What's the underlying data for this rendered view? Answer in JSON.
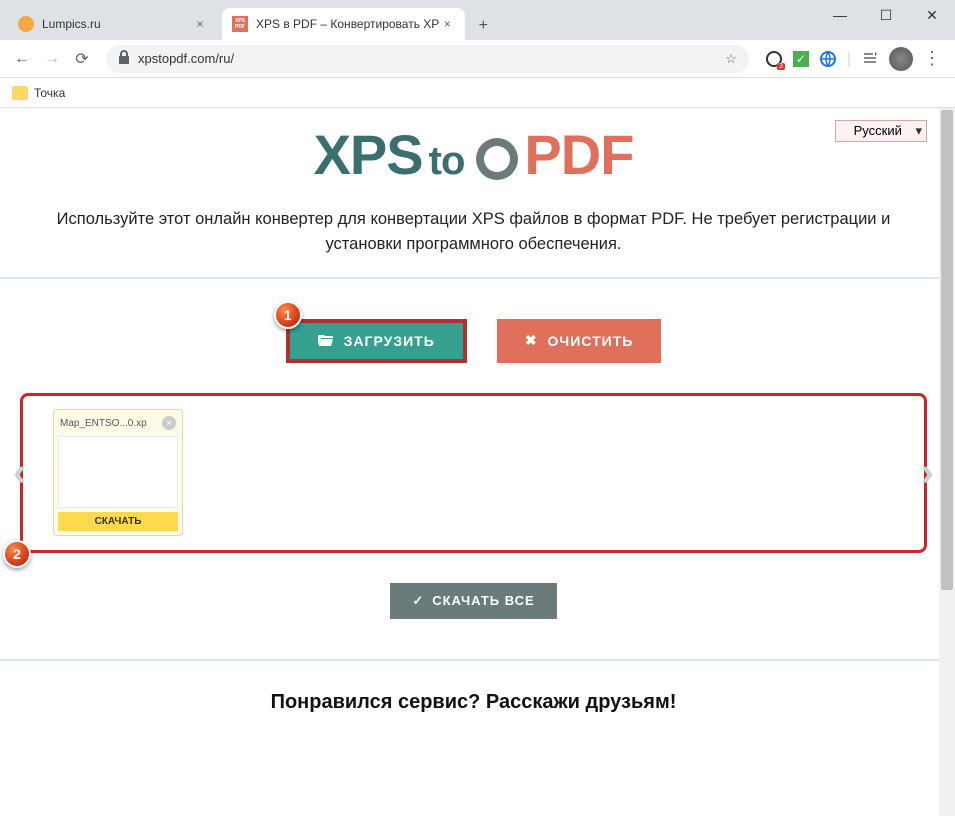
{
  "browser": {
    "tabs": [
      {
        "title": "Lumpics.ru",
        "favicon_color": "#f4a83d"
      },
      {
        "title": "XPS в PDF – Конвертировать XP",
        "favicon_text": "XPS\nPDF",
        "favicon_bg": "#e0705c"
      }
    ],
    "url": "xpstopdf.com/ru/"
  },
  "bookmarks": {
    "item1": "Точка"
  },
  "page": {
    "logo": {
      "xps": "XPS",
      "to": "to",
      "pdf": "PDF"
    },
    "lang": "Русский",
    "description": "Используйте этот онлайн конвертер для конвертации XPS файлов в формат PDF. Не требует регистрации и установки программного обеспечения.",
    "upload_label": "ЗАГРУЗИТЬ",
    "clear_label": "ОЧИСТИТЬ",
    "file": {
      "name": "Map_ENTSO...0.xp",
      "download": "СКАЧАТЬ"
    },
    "download_all": "СКАЧАТЬ ВСЕ",
    "share": "Понравился сервис? Расскажи друзьям!"
  },
  "callouts": {
    "one": "1",
    "two": "2"
  }
}
